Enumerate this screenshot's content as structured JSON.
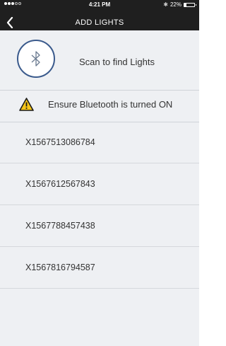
{
  "status_bar": {
    "time": "4:21 PM",
    "battery_text": "22%",
    "battery_level": 0.22
  },
  "nav": {
    "title": "ADD LIGHTS",
    "back_icon": "chevron-left-icon"
  },
  "scan": {
    "label": "Scan to find Lights",
    "icon": "bluetooth-icon"
  },
  "warning": {
    "label": "Ensure Bluetooth is turned ON",
    "icon": "warning-icon",
    "color": "#f5c518"
  },
  "devices": [
    {
      "id": "X1567513086784"
    },
    {
      "id": "X1567612567843"
    },
    {
      "id": "X1567788457438"
    },
    {
      "id": "X1567816794587"
    }
  ]
}
